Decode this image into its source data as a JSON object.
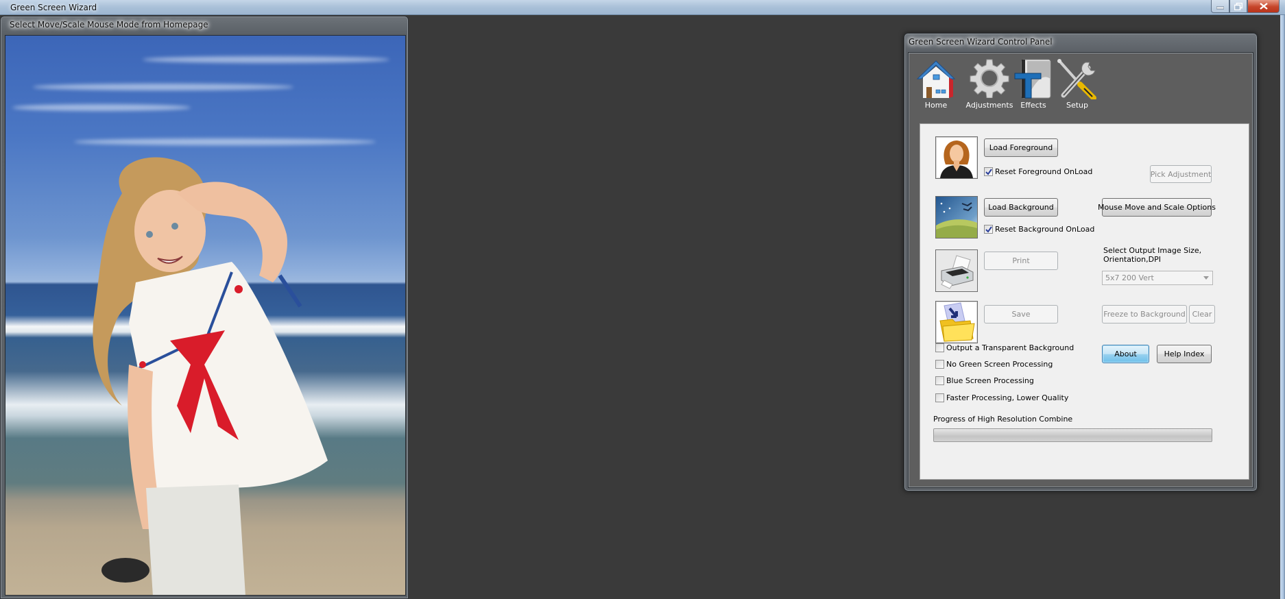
{
  "app": {
    "title": "Green Screen Wizard",
    "window_controls": {
      "minimize": "minimize-icon",
      "maximize": "restore-icon",
      "close": "close-icon"
    }
  },
  "image_window": {
    "caption": "Select Move/Scale Mouse Mode from Homepage",
    "scene": "girl in sailor outfit composited onto beach background"
  },
  "control_panel": {
    "title": "Green Screen Wizard Control Panel",
    "toolbar": [
      {
        "label": "Home",
        "icon": "home-icon"
      },
      {
        "label": "Adjustments",
        "icon": "gear-icon"
      },
      {
        "label": "Effects",
        "icon": "text-effects-icon"
      },
      {
        "label": "Setup",
        "icon": "tools-icon"
      }
    ],
    "foreground": {
      "icon": "person-icon",
      "load_label": "Load Foreground",
      "reset_label": "Reset Foreground OnLoad",
      "reset_checked": true
    },
    "background": {
      "icon": "landscape-icon",
      "load_label": "Load Background",
      "reset_label": "Reset Background OnLoad",
      "reset_checked": true
    },
    "print": {
      "icon": "printer-icon",
      "label": "Print",
      "enabled": false
    },
    "save": {
      "icon": "save-folder-icon",
      "label": "Save",
      "enabled": false
    },
    "pick_adjustment_label": "Pick Adjustment",
    "mouse_options_label": "Mouse Move and Scale Options",
    "output_size": {
      "label": "Select Output Image Size, Orientation,DPI",
      "selected": "5x7 200 Vert"
    },
    "freeze_label": "Freeze to Background",
    "clear_label": "Clear",
    "about_label": "About",
    "help_label": "Help Index",
    "options": [
      {
        "label": "Output a Transparent Background",
        "checked": false
      },
      {
        "label": "No Green Screen Processing",
        "checked": false
      },
      {
        "label": "Blue Screen Processing",
        "checked": false
      },
      {
        "label": "Faster Processing, Lower Quality",
        "checked": false
      }
    ],
    "progress": {
      "label": "Progress of High Resolution Combine",
      "value_percent": 0
    }
  }
}
